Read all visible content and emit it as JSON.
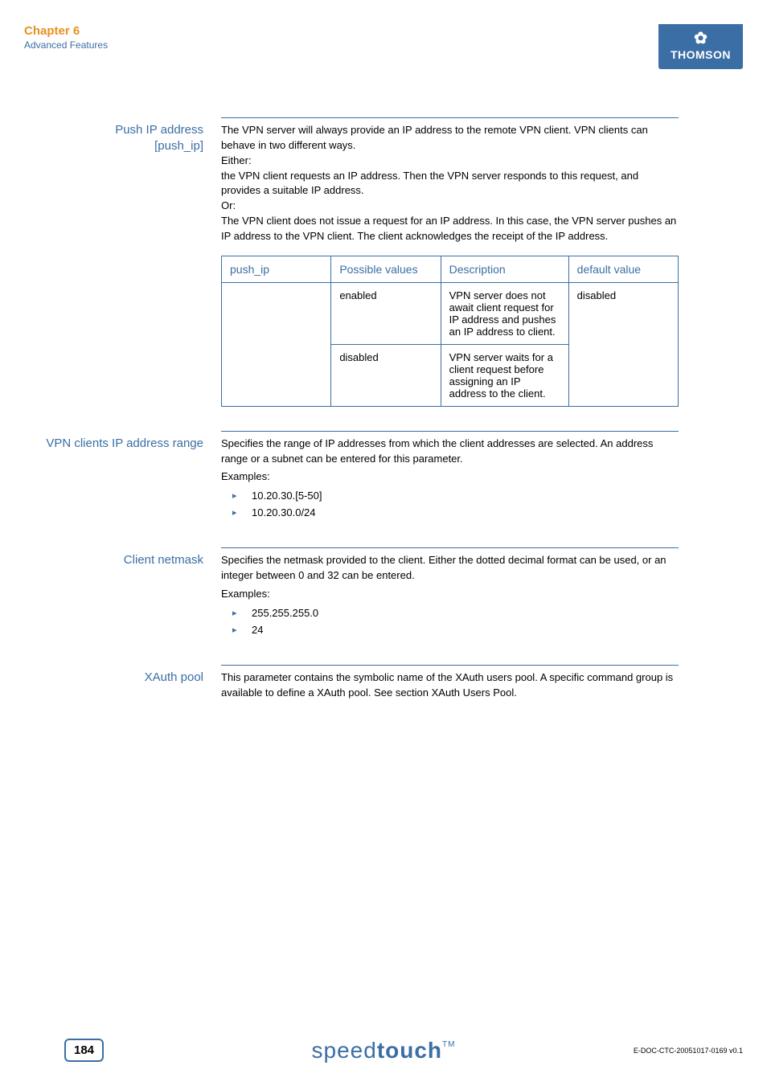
{
  "header": {
    "chapter_title": "Chapter 6",
    "chapter_subtitle": "Advanced Features",
    "brand": "THOMSON"
  },
  "sections": {
    "push_ip": {
      "label_line1": "Push IP address",
      "label_line2": "[push_ip]",
      "body": "The VPN server will always provide an IP address to the remote VPN client. VPN clients can behave in two different ways.",
      "either": "Either:",
      "either_body": "the VPN client requests an IP address. Then the VPN server responds to this request, and provides a suitable IP address.",
      "or": "Or:",
      "or_body": "The VPN client does not issue a request for an IP address. In this case, the VPN server pushes an IP address to the VPN client. The client acknowledges the receipt of the IP address.",
      "table": {
        "headers": [
          "push_ip",
          "Possible values",
          "Description",
          "default value"
        ],
        "rows": [
          {
            "param": "",
            "value": "enabled",
            "desc": "VPN server does not await client request for IP address and pushes an IP address to client.",
            "default": "disabled"
          },
          {
            "param": "",
            "value": "disabled",
            "desc": "VPN server waits for a client request before assigning an IP address to the client.",
            "default": ""
          }
        ]
      }
    },
    "vpn_range": {
      "label": "VPN clients IP address range",
      "body": "Specifies the range of IP addresses from which the client addresses are selected. An address range or a subnet can be entered for this parameter.",
      "examples_label": "Examples:",
      "examples": [
        "10.20.30.[5-50]",
        "10.20.30.0/24"
      ]
    },
    "client_netmask": {
      "label": "Client netmask",
      "body": "Specifies the netmask provided to the client. Either the dotted decimal format can be used, or an integer between 0 and 32 can be entered.",
      "examples_label": "Examples:",
      "examples": [
        "255.255.255.0",
        "24"
      ]
    },
    "xauth_pool": {
      "label": "XAuth pool",
      "body": "This parameter contains the symbolic name of the XAuth users pool. A specific command group is available to define a XAuth pool. See section XAuth Users Pool."
    }
  },
  "footer": {
    "page_number": "184",
    "brand_light": "speed",
    "brand_bold": "touch",
    "tm": "TM",
    "doc_id": "E-DOC-CTC-20051017-0169 v0.1"
  }
}
